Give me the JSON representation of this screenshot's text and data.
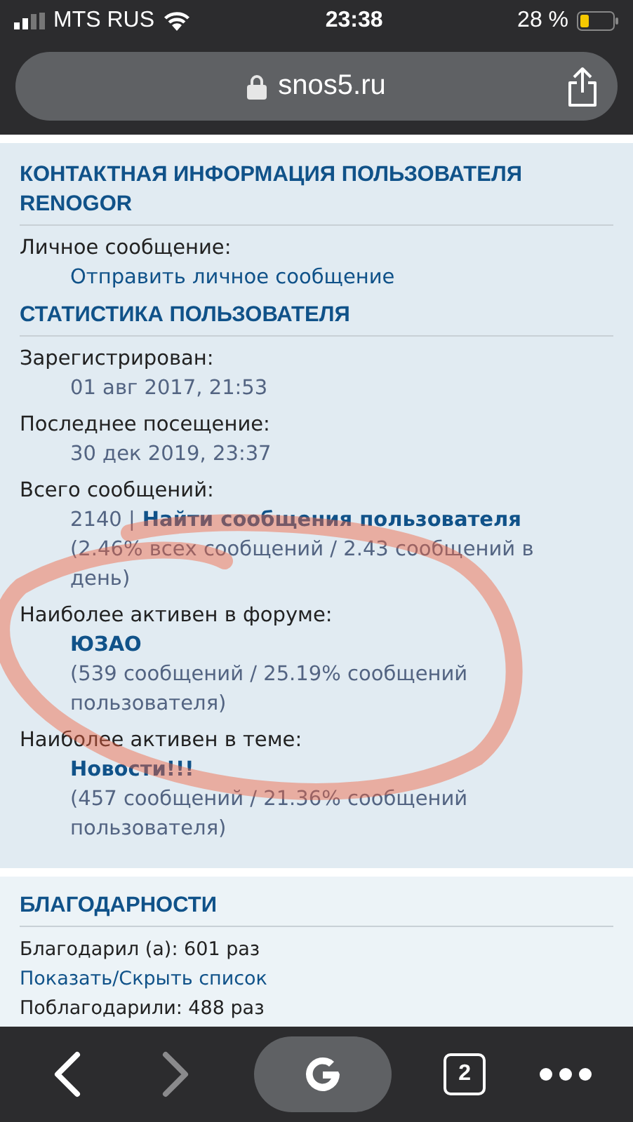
{
  "status_bar": {
    "carrier": "MTS RUS",
    "time": "23:38",
    "battery": "28 %"
  },
  "address_bar": {
    "url": "snos5.ru"
  },
  "contact": {
    "title": "КОНТАКТНАЯ ИНФОРМАЦИЯ ПОЛЬЗОВАТЕЛЯ RENOGOR",
    "items": [
      {
        "label": "Личное сообщение:",
        "parts": [
          {
            "kind": "link",
            "text": "Отправить личное сообщение"
          }
        ]
      }
    ]
  },
  "statistics": {
    "title": "СТАТИСТИКА ПОЛЬЗОВАТЕЛЯ",
    "items": [
      {
        "label": "Зарегистрирован:",
        "parts": [
          {
            "kind": "text",
            "text": "01 авг 2017, 21:53"
          }
        ]
      },
      {
        "label": "Последнее посещение:",
        "parts": [
          {
            "kind": "text",
            "text": "30 дек 2019, 23:37"
          }
        ]
      },
      {
        "label": "Всего сообщений:",
        "parts": [
          {
            "kind": "text",
            "text": "2140 |"
          },
          {
            "kind": "strong",
            "text": "Найти сообщения пользователя"
          },
          {
            "kind": "note",
            "text": "(2.46% всех сообщений / 2.43 сообщений в день)"
          }
        ]
      },
      {
        "label": "Наиболее активен в форуме:",
        "parts": [
          {
            "kind": "strong",
            "text": "ЮЗАО"
          },
          {
            "kind": "note",
            "text": "(539 сообщений / 25.19% сообщений пользователя)"
          }
        ]
      },
      {
        "label": "Наиболее активен в теме:",
        "parts": [
          {
            "kind": "strong",
            "text": "Новости!!!"
          },
          {
            "kind": "note",
            "text": "(457 сообщений / 21.36% сообщений пользователя)"
          }
        ]
      }
    ]
  },
  "thanks": {
    "title": "БЛАГОДАРНОСТИ",
    "lines": [
      {
        "kind": "text",
        "text": "Благодарил (а): 601 раз"
      },
      {
        "kind": "link",
        "text": "Показать/Скрыть список"
      },
      {
        "kind": "text",
        "text": "Поблагодарили: 488 раз"
      }
    ]
  },
  "toolbar": {
    "buttons": [
      {
        "kind": "back",
        "disabled": false
      },
      {
        "kind": "forward",
        "disabled": true
      },
      {
        "kind": "google",
        "disabled": false
      },
      {
        "kind": "tabs",
        "count": "2",
        "disabled": false
      },
      {
        "kind": "more",
        "disabled": false
      }
    ]
  }
}
